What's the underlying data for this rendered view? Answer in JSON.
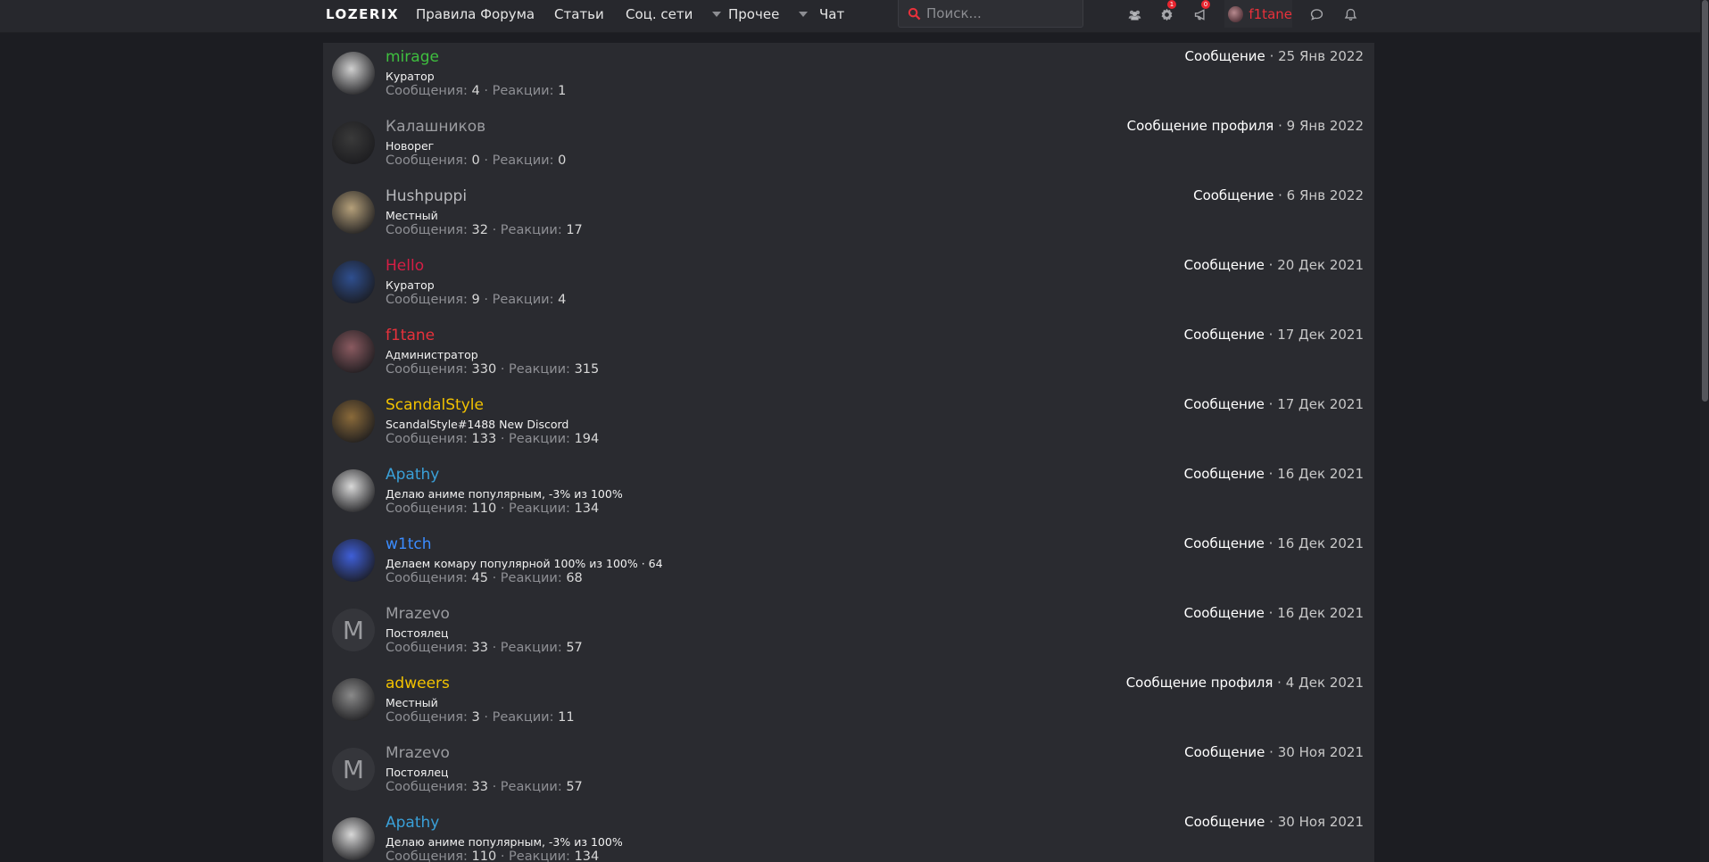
{
  "nav": {
    "logo": "LOZERIX",
    "links": [
      "Правила Форума",
      "Статьи",
      "Соц. сети",
      "Прочее",
      "Чат"
    ],
    "search_placeholder": "Поиск...",
    "badges": {
      "settings": "1",
      "alerts": "0"
    },
    "username": "f1tane"
  },
  "members": [
    {
      "name": "mirage",
      "name_color": "#3fbf3f",
      "title": "Куратор",
      "messages": "4",
      "reactions": "1",
      "activity": "Сообщение",
      "date": "25 Янв 2022",
      "avatar": "photo",
      "avatar_color": "#cfcfcf"
    },
    {
      "name": "Калашников",
      "name_color": "#9b9ca0",
      "title": "Новорег",
      "messages": "0",
      "reactions": "0",
      "activity": "Сообщение профиля",
      "date": "9 Янв 2022",
      "avatar": "photo",
      "avatar_color": "#3a3a3a"
    },
    {
      "name": "Hushpuppi",
      "name_color": "#b8b9bd",
      "title": "Местный",
      "messages": "32",
      "reactions": "17",
      "activity": "Сообщение",
      "date": "6 Янв 2022",
      "avatar": "photo",
      "avatar_color": "#b5a07a"
    },
    {
      "name": "Hello",
      "name_color": "#d61e45",
      "title": "Куратор",
      "messages": "9",
      "reactions": "4",
      "activity": "Сообщение",
      "date": "20 Дек 2021",
      "avatar": "photo",
      "avatar_color": "#2f4f8f"
    },
    {
      "name": "f1tane",
      "name_color": "#e8313b",
      "title": "Администратор",
      "messages": "330",
      "reactions": "315",
      "activity": "Сообщение",
      "date": "17 Дек 2021",
      "avatar": "photo",
      "avatar_color": "#8a5a60"
    },
    {
      "name": "ScandalStyle",
      "name_color": "#f2c200",
      "title": "ScandalStyle#1488 New Discord",
      "messages": "133",
      "reactions": "194",
      "activity": "Сообщение",
      "date": "17 Дек 2021",
      "avatar": "photo",
      "avatar_color": "#8a6a3a"
    },
    {
      "name": "Apathy",
      "name_color": "#3aa0d8",
      "title": "Делаю аниме популярным, -3% из 100%",
      "messages": "110",
      "reactions": "134",
      "activity": "Сообщение",
      "date": "16 Дек 2021",
      "avatar": "photo",
      "avatar_color": "#d8d8d8"
    },
    {
      "name": "w1tch",
      "name_color": "#3b8cff",
      "title": "Делаем комару популярной 100% из 100% · 64",
      "messages": "45",
      "reactions": "68",
      "activity": "Сообщение",
      "date": "16 Дек 2021",
      "avatar": "photo",
      "avatar_color": "#3f5fd8"
    },
    {
      "name": "Mrazevo",
      "name_color": "#9b9ca0",
      "title": "Постоялец",
      "messages": "33",
      "reactions": "57",
      "activity": "Сообщение",
      "date": "16 Дек 2021",
      "avatar": "letter",
      "letter": "M"
    },
    {
      "name": "adweers",
      "name_color": "#f2c200",
      "title": "Местный",
      "messages": "3",
      "reactions": "11",
      "activity": "Сообщение профиля",
      "date": "4 Дек 2021",
      "avatar": "photo",
      "avatar_color": "#8a8a8a"
    },
    {
      "name": "Mrazevo",
      "name_color": "#9b9ca0",
      "title": "Постоялец",
      "messages": "33",
      "reactions": "57",
      "activity": "Сообщение",
      "date": "30 Ноя 2021",
      "avatar": "letter",
      "letter": "M"
    },
    {
      "name": "Apathy",
      "name_color": "#3aa0d8",
      "title": "Делаю аниме популярным, -3% из 100%",
      "messages": "110",
      "reactions": "134",
      "activity": "Сообщение",
      "date": "30 Ноя 2021",
      "avatar": "photo",
      "avatar_color": "#d8d8d8"
    }
  ],
  "labels": {
    "messages": "Сообщения:",
    "reactions": "Реакции:",
    "sep": "·"
  }
}
